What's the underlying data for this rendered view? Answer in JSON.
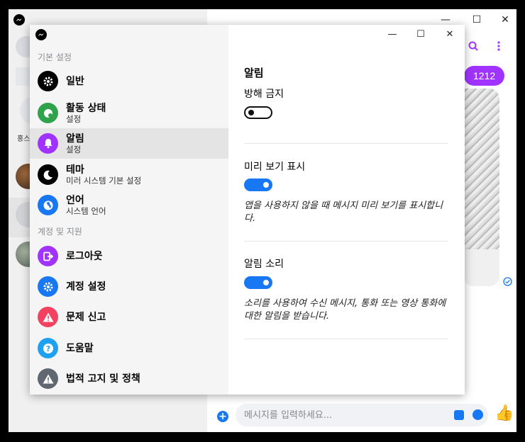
{
  "background_window": {
    "titlebar_buttons": [
      "—",
      "☐",
      "✕"
    ],
    "left_label_fragment": "홍스",
    "chat": {
      "bubble_text": "1212",
      "composer_placeholder": "메시지를 입력하세요..."
    }
  },
  "settings": {
    "window_buttons": [
      "—",
      "☐",
      "✕"
    ],
    "sections": {
      "basic": "기본 설정",
      "account": "계정 및 지원"
    },
    "menu": [
      {
        "title": "일반",
        "subtitle": "",
        "icon": "gear-icon",
        "color": "#000000"
      },
      {
        "title": "활동 상태",
        "subtitle": "설정",
        "icon": "activity-icon",
        "color": "#31a24c"
      },
      {
        "title": "알림",
        "subtitle": "설정",
        "icon": "bell-icon",
        "color": "#a033ff"
      },
      {
        "title": "테마",
        "subtitle": "미러 시스템 기본 설정",
        "icon": "moon-icon",
        "color": "#000000"
      },
      {
        "title": "언어",
        "subtitle": "시스템 언어",
        "icon": "globe-icon",
        "color": "#1877f2"
      },
      {
        "title": "로그아웃",
        "subtitle": "",
        "icon": "logout-icon",
        "color": "#a033ff"
      },
      {
        "title": "계정 설정",
        "subtitle": "",
        "icon": "gear-icon",
        "color": "#1877f2"
      },
      {
        "title": "문제 신고",
        "subtitle": "",
        "icon": "warning-icon",
        "color": "#f3425f"
      },
      {
        "title": "도움말",
        "subtitle": "",
        "icon": "help-icon",
        "color": "#1ea1f1"
      },
      {
        "title": "법적 고지 및 정책",
        "subtitle": "",
        "icon": "warning-icon",
        "color": "#606770"
      }
    ],
    "active_index": 2,
    "panel": {
      "title": "알림",
      "dnd_label": "방해 금지",
      "dnd_on": false,
      "preview_label": "미리 보기 표시",
      "preview_on": true,
      "preview_desc": "앱을 사용하지 않을 때 메시지 미리 보기를 표시합니다.",
      "sound_label": "알림 소리",
      "sound_on": true,
      "sound_desc": "소리를 사용하여 수신 메시지, 통화 또는 영상 통화에 대한 알림을 받습니다."
    }
  },
  "colors": {
    "accent_blue": "#1877f2",
    "accent_purple": "#a033ff"
  }
}
